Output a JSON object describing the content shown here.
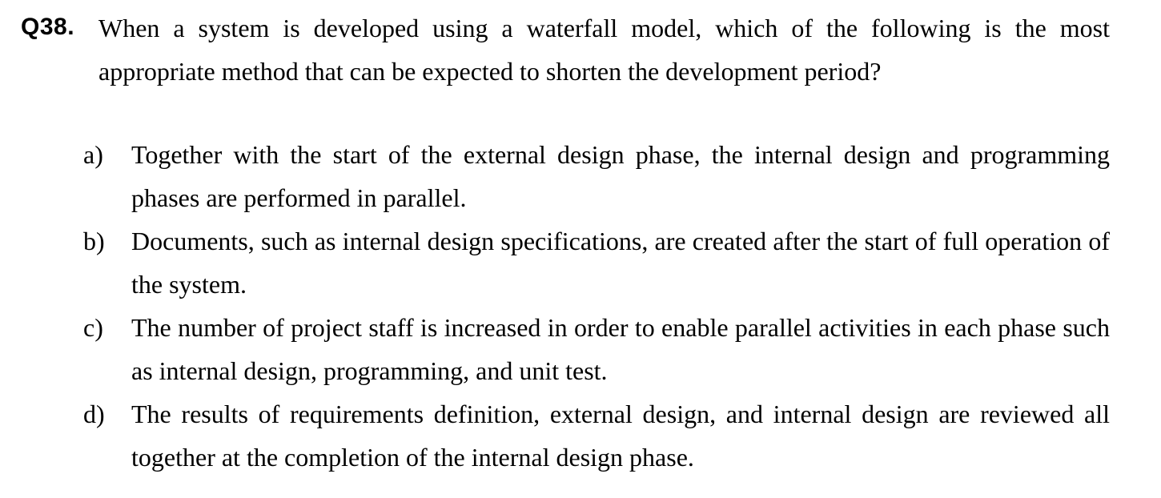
{
  "question": {
    "number": "Q38.",
    "text": "When a system is developed using a waterfall model, which of the following is the most appropriate method that can be expected to shorten the development period?"
  },
  "options": [
    {
      "letter": "a)",
      "text": "Together with the start of the external design phase, the internal design and programming phases are performed in parallel."
    },
    {
      "letter": "b)",
      "text": "Documents, such as internal design specifications, are created after the start of full operation of the system."
    },
    {
      "letter": "c)",
      "text": "The number of project staff is increased in order to enable parallel activities in each phase such as internal design, programming, and unit test."
    },
    {
      "letter": "d)",
      "text": "The results of requirements definition, external design, and internal design are reviewed all together at the completion of the internal design phase."
    }
  ]
}
